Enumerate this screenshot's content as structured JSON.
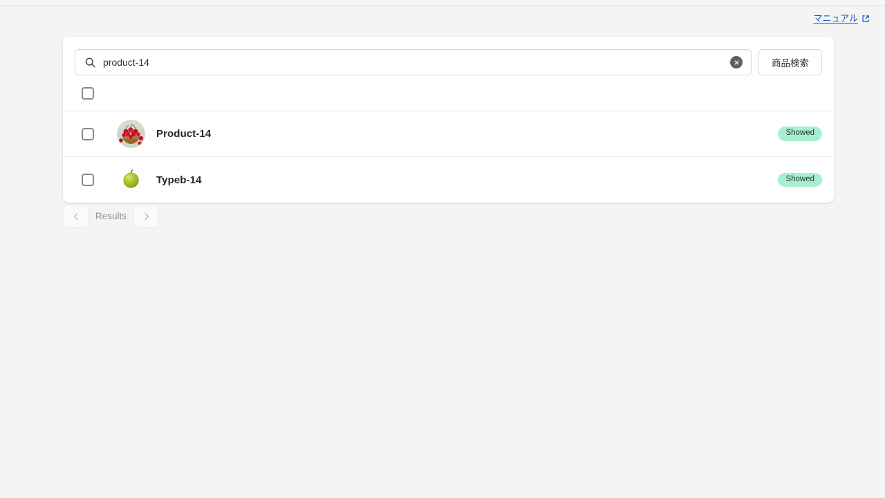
{
  "header": {
    "manual_link_label": "マニュアル",
    "manual_link_icon": "external-link-icon",
    "link_color": "#1a56db"
  },
  "search": {
    "icon": "search-icon",
    "value": "product-14",
    "placeholder": "",
    "clear_icon": "clear-circle-icon",
    "submit_label": "商品検索"
  },
  "list": {
    "select_all_checked": false,
    "rows": [
      {
        "checked": false,
        "thumbnail": "cherries-in-bowl-thumbnail",
        "name": "Product-14",
        "status": "Showed"
      },
      {
        "checked": false,
        "thumbnail": "green-apple-thumbnail",
        "name": "Typeb-14",
        "status": "Showed"
      }
    ]
  },
  "pagination": {
    "prev_icon": "chevron-left-icon",
    "label": "Results",
    "next_icon": "chevron-right-icon"
  },
  "colors": {
    "page_background": "#f4f4f5",
    "card_background": "#ffffff",
    "badge_background": "#a6efcf",
    "badge_text": "#253238",
    "link": "#1a56db"
  }
}
